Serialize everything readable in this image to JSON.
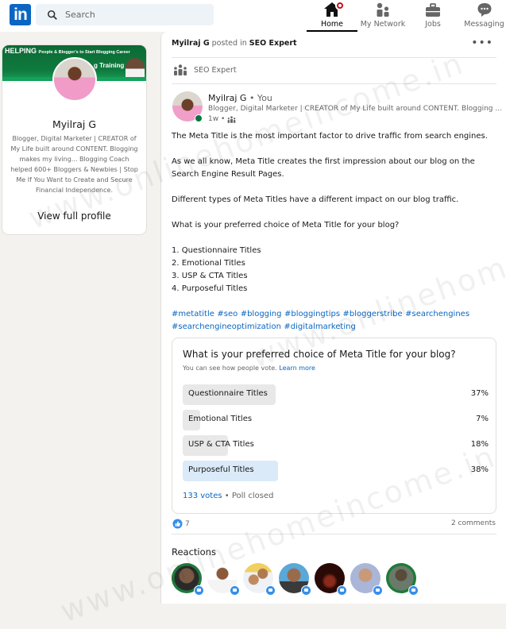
{
  "nav": {
    "logo": "in",
    "search_placeholder": "Search",
    "items": [
      {
        "label": "Home",
        "icon": "home-icon",
        "active": true,
        "badge": true
      },
      {
        "label": "My Network",
        "icon": "network-icon",
        "active": false
      },
      {
        "label": "Jobs",
        "icon": "briefcase-icon",
        "active": false
      },
      {
        "label": "Messaging",
        "icon": "chat-icon",
        "active": false
      }
    ]
  },
  "profile": {
    "banner_heading": "HELPING",
    "banner_text": "People & Blogger's to Start Blogging Career",
    "banner_sub": "g Training",
    "name": "Myilraj G",
    "headline": "Blogger, Digital Marketer | CREATOR of My Life built around CONTENT. Blogging makes my living... Blogging Coach helped 600+ Bloggers & Newbies | Stop Me If You Want to Create and Secure Financial Independence.",
    "view_profile": "View full profile"
  },
  "post": {
    "poster": "Myilraj G",
    "posted_in": "posted in",
    "group": "SEO Expert",
    "group_row_label": "SEO Expert",
    "author": "Myilraj G",
    "author_relation": " • You",
    "author_headline": "Blogger, Digital Marketer | CREATOR of My Life built around CONTENT. Blogging ...",
    "time": "1w •",
    "paragraphs": [
      "The Meta Title is the most important factor to drive traffic from search engines.",
      "As we all know, Meta Title creates the first impression about our blog on the Search Engine Result Pages.",
      "Different types of Meta Titles have a different impact on our blog traffic.",
      "What is your preferred choice of Meta Title for your blog?"
    ],
    "list": [
      "1. Questionnaire Titles",
      "2. Emotional Titles",
      "3. USP & CTA Titles",
      "4. Purposeful Titles"
    ],
    "hashtags": [
      "#metatitle",
      "#seo",
      "#blogging",
      "#bloggingtips",
      "#bloggerstribe",
      "#searchengines",
      "#searchengineoptimization",
      "#digitalmarketing"
    ],
    "poll": {
      "question": "What is your preferred choice of Meta Title for your blog?",
      "visibility_note": "You can see how people vote.",
      "learn_more": "Learn more",
      "options": [
        {
          "label": "Questionnaire Titles",
          "percent": 37,
          "percent_label": "37%",
          "selected": false
        },
        {
          "label": "Emotional Titles",
          "percent": 7,
          "percent_label": "7%",
          "selected": false
        },
        {
          "label": "USP & CTA Titles",
          "percent": 18,
          "percent_label": "18%",
          "selected": false
        },
        {
          "label": "Purposeful Titles",
          "percent": 38,
          "percent_label": "38%",
          "selected": true
        }
      ],
      "votes": "133 votes",
      "status": " • Poll closed"
    },
    "likes_count": "7",
    "comments_count": "2 comments",
    "reactions_title": "Reactions",
    "reactor_count": 7
  },
  "watermark": "www.onlinehomeincome.in",
  "colors": {
    "brand": "#0a66c2",
    "selected_poll": "#dbeaf8",
    "poll_bar": "#e8e8e8",
    "online": "#057642",
    "badge": "#cc1016"
  }
}
